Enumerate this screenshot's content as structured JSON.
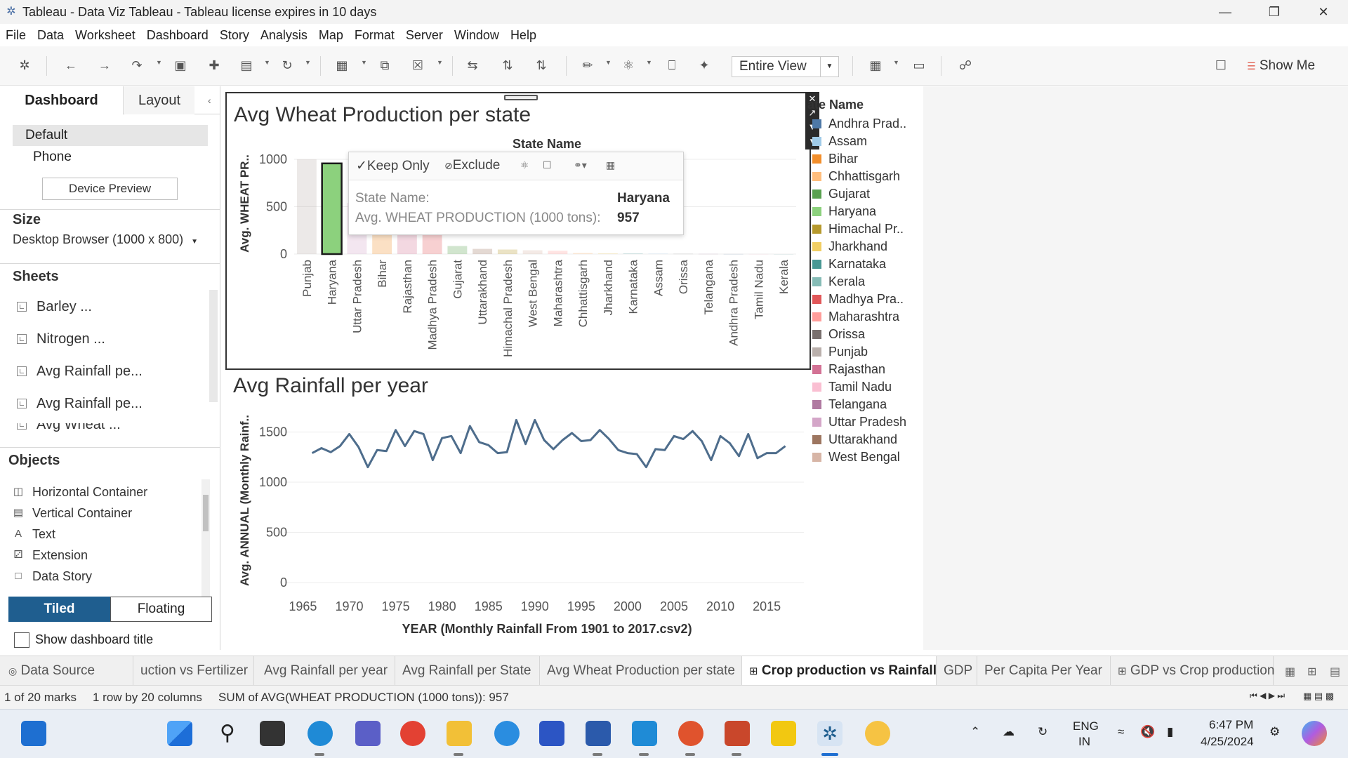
{
  "window": {
    "title": "Tableau - Data Viz Tableau - Tableau license expires in 10 days"
  },
  "menu": [
    "File",
    "Data",
    "Worksheet",
    "Dashboard",
    "Story",
    "Analysis",
    "Map",
    "Format",
    "Server",
    "Window",
    "Help"
  ],
  "toolbar": {
    "view_select": "Entire View",
    "show_me": "Show Me"
  },
  "left_panel": {
    "tabs": {
      "dashboard": "Dashboard",
      "layout": "Layout"
    },
    "devices": {
      "default": "Default",
      "phone": "Phone",
      "preview_button": "Device Preview"
    },
    "size": {
      "title": "Size",
      "value": "Desktop Browser (1000 x 800)"
    },
    "sheets": {
      "title": "Sheets",
      "items": [
        "Barley ...",
        "Nitrogen ...",
        "Avg Rainfall pe...",
        "Avg Rainfall pe...",
        "Avg Wheat ..."
      ]
    },
    "objects": {
      "title": "Objects",
      "items": [
        "Horizontal Container",
        "Vertical Container",
        "Text",
        "Extension",
        "Data Story"
      ]
    },
    "layout_mode": {
      "tiled": "Tiled",
      "floating": "Floating"
    },
    "show_title": "Show dashboard title"
  },
  "wheat_chart": {
    "title": "Avg Wheat Production per state",
    "header": "State Name",
    "y_axis_label": "Avg. WHEAT PR..",
    "y_ticks": [
      "1000",
      "500",
      "0"
    ],
    "selected_state": "Haryana"
  },
  "rain_chart": {
    "title": "Avg Rainfall per year",
    "y_axis_label": "Avg. ANNUAL (Monthly Rainf..",
    "x_axis_label": "YEAR (Monthly Rainfall From 1901 to 2017.csv2)",
    "y_ticks": [
      "1500",
      "1000",
      "500",
      "0"
    ],
    "x_ticks": [
      "1965",
      "1970",
      "1975",
      "1980",
      "1985",
      "1990",
      "1995",
      "2000",
      "2005",
      "2010",
      "2015"
    ]
  },
  "tooltip": {
    "keep_only": "Keep Only",
    "exclude": "Exclude",
    "label_state": "State Name:",
    "value_state": "Haryana",
    "label_measure": "Avg. WHEAT PRODUCTION (1000 tons):",
    "value_measure": "957"
  },
  "legend": {
    "title": "State Name",
    "title_visible": "ate Name",
    "items": [
      {
        "name": "Andhra Prad..",
        "color": "#4e79a7"
      },
      {
        "name": "Assam",
        "color": "#a0cbe8"
      },
      {
        "name": "Bihar",
        "color": "#f28e2b"
      },
      {
        "name": "Chhattisgarh",
        "color": "#ffbe7d"
      },
      {
        "name": "Gujarat",
        "color": "#59a14f"
      },
      {
        "name": "Haryana",
        "color": "#8cd17d"
      },
      {
        "name": "Himachal Pr..",
        "color": "#b6992d"
      },
      {
        "name": "Jharkhand",
        "color": "#f1ce63"
      },
      {
        "name": "Karnataka",
        "color": "#499894"
      },
      {
        "name": "Kerala",
        "color": "#86bcb6"
      },
      {
        "name": "Madhya Pra..",
        "color": "#e15759"
      },
      {
        "name": "Maharashtra",
        "color": "#ff9d9a"
      },
      {
        "name": "Orissa",
        "color": "#79706e"
      },
      {
        "name": "Punjab",
        "color": "#bab0ac"
      },
      {
        "name": "Rajasthan",
        "color": "#d37295"
      },
      {
        "name": "Tamil Nadu",
        "color": "#fabfd2"
      },
      {
        "name": "Telangana",
        "color": "#b07aa1"
      },
      {
        "name": "Uttar Pradesh",
        "color": "#d4a6c8"
      },
      {
        "name": "Uttarakhand",
        "color": "#9d7660"
      },
      {
        "name": "West Bengal",
        "color": "#d7b5a6"
      }
    ]
  },
  "chart_data": [
    {
      "type": "bar",
      "title": "Avg Wheat Production per state",
      "xlabel": "State Name",
      "ylabel": "Avg. WHEAT PR..",
      "ylim": [
        0,
        1000
      ],
      "categories": [
        "Punjab",
        "Haryana",
        "Uttar Pradesh",
        "Bihar",
        "Rajasthan",
        "Madhya Pradesh",
        "Gujarat",
        "Uttarakhand",
        "Himachal Pradesh",
        "West Bengal",
        "Maharashtra",
        "Chhattisgarh",
        "Jharkhand",
        "Karnataka",
        "Assam",
        "Orissa",
        "Telangana",
        "Andhra Pradesh",
        "Tamil Nadu",
        "Kerala"
      ],
      "values": [
        1000,
        957,
        540,
        230,
        220,
        200,
        85,
        55,
        48,
        40,
        35,
        12,
        8,
        6,
        5,
        3,
        2,
        1,
        1,
        0
      ],
      "colors": [
        "#bab0ac",
        "#8cd17d",
        "#d4a6c8",
        "#f28e2b",
        "#d37295",
        "#e15759",
        "#59a14f",
        "#9d7660",
        "#b6992d",
        "#d7b5a6",
        "#ff9d9a",
        "#ffbe7d",
        "#f1ce63",
        "#499894",
        "#a0cbe8",
        "#79706e",
        "#b07aa1",
        "#4e79a7",
        "#fabfd2",
        "#86bcb6"
      ],
      "grid": true,
      "legend": "right"
    },
    {
      "type": "line",
      "title": "Avg Rainfall per year",
      "xlabel": "YEAR (Monthly Rainfall From 1901 to 2017.csv2)",
      "ylabel": "Avg. ANNUAL (Monthly Rainf..",
      "ylim": [
        0,
        1700
      ],
      "xlim": [
        1963,
        2019
      ],
      "series": [
        {
          "color": "#4e6d8c",
          "x": [
            1966,
            1967,
            1968,
            1969,
            1970,
            1971,
            1972,
            1973,
            1974,
            1975,
            1976,
            1977,
            1978,
            1979,
            1980,
            1981,
            1982,
            1983,
            1984,
            1985,
            1986,
            1987,
            1988,
            1989,
            1990,
            1991,
            1992,
            1993,
            1994,
            1995,
            1996,
            1997,
            1998,
            1999,
            2000,
            2001,
            2002,
            2003,
            2004,
            2005,
            2006,
            2007,
            2008,
            2009,
            2010,
            2011,
            2012,
            2013,
            2014,
            2015,
            2016,
            2017
          ],
          "values": [
            1290,
            1340,
            1300,
            1360,
            1480,
            1350,
            1150,
            1320,
            1310,
            1520,
            1360,
            1510,
            1480,
            1220,
            1440,
            1460,
            1290,
            1560,
            1400,
            1370,
            1290,
            1300,
            1620,
            1380,
            1620,
            1420,
            1330,
            1420,
            1490,
            1410,
            1420,
            1520,
            1430,
            1320,
            1290,
            1280,
            1150,
            1330,
            1320,
            1460,
            1430,
            1510,
            1410,
            1220,
            1460,
            1390,
            1260,
            1480,
            1240,
            1290,
            1290,
            1360
          ]
        }
      ],
      "grid": true
    }
  ],
  "sheet_tabs": [
    "Data Source",
    "uction vs Fertilizer",
    "Avg Rainfall per year",
    "Avg Rainfall per State",
    "Avg Wheat Production per state",
    "Crop production vs Rainfall",
    "GDP",
    "Per Capita Per Year",
    "GDP vs Crop production"
  ],
  "status": {
    "marks": "1 of 20 marks",
    "dims": "1 row by 20 columns",
    "sum": "SUM of AVG(WHEAT PRODUCTION (1000 tons)): 957"
  },
  "taskbar": {
    "lang_1": "ENG",
    "lang_2": "IN",
    "time": "6:47 PM",
    "date": "4/25/2024"
  },
  "colors": {
    "accent": "#1f5e8f",
    "line": "#4e6d8c",
    "selected_bar": "#8cd17d"
  }
}
